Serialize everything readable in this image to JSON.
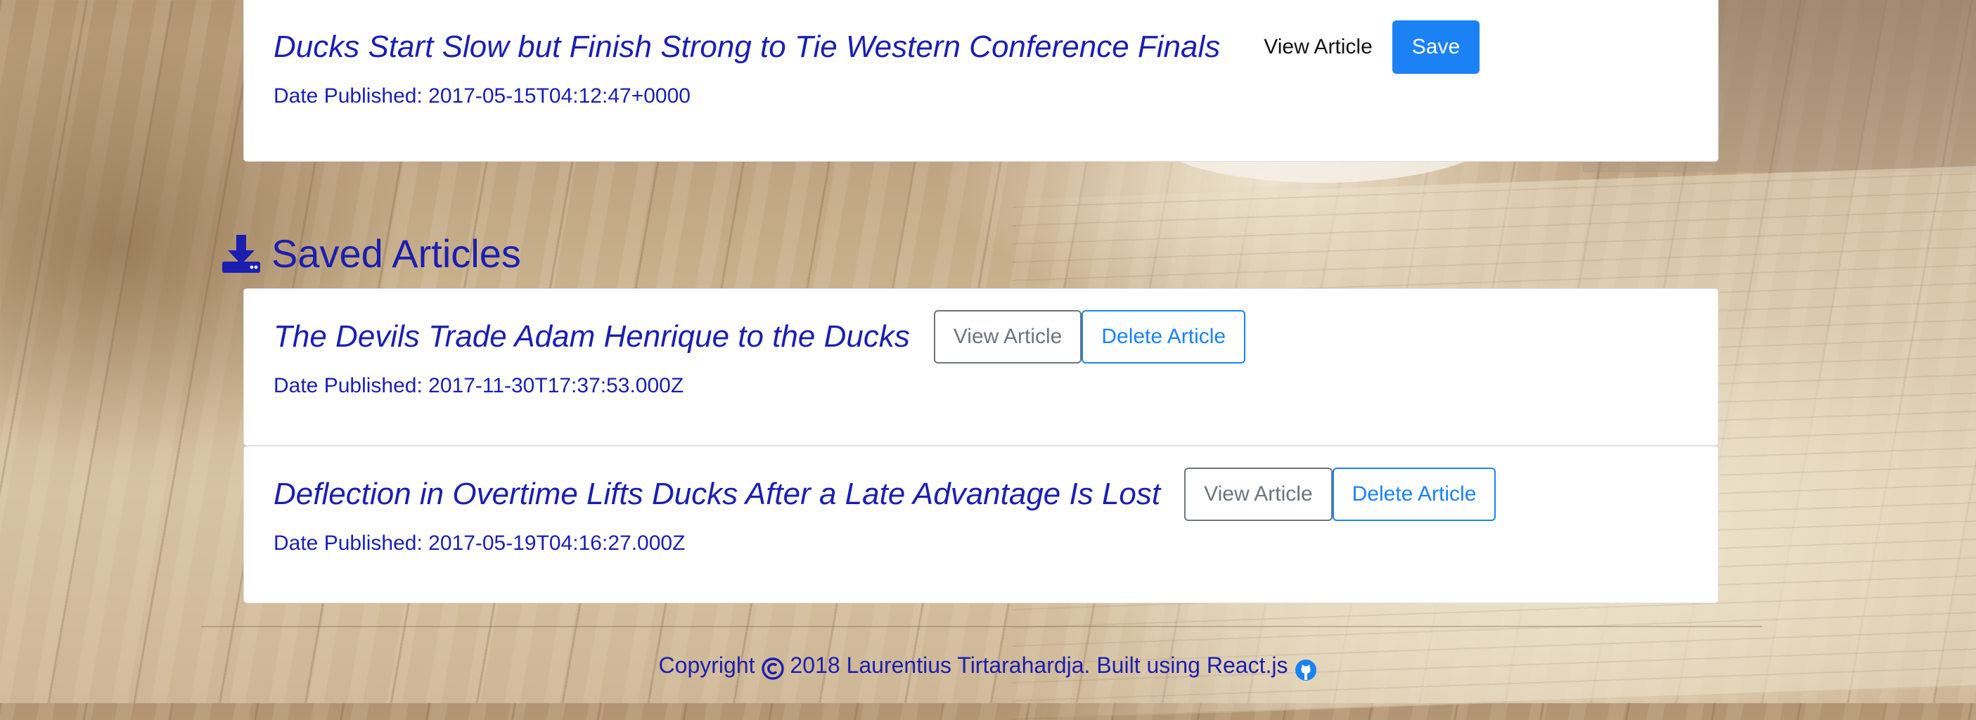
{
  "search_results": {
    "articles": [
      {
        "title": "Ducks Start Slow but Finish Strong to Tie Western Conference Finals",
        "view_label": "View Article",
        "action_label": "Save",
        "date_text": "Date Published: 2017-05-15T04:12:47+0000"
      }
    ]
  },
  "saved": {
    "heading": "Saved Articles",
    "heading_icon": "download-icon",
    "articles": [
      {
        "title": "The Devils Trade Adam Henrique to the Ducks",
        "view_label": "View Article",
        "action_label": "Delete Article",
        "date_text": "Date Published: 2017-11-30T17:37:53.000Z"
      },
      {
        "title": "Deflection in Overtime Lifts Ducks After a Late Advantage Is Lost",
        "view_label": "View Article",
        "action_label": "Delete Article",
        "date_text": "Date Published: 2017-05-19T04:16:27.000Z"
      }
    ]
  },
  "footer": {
    "copyright_label": "Copyright",
    "copyright_icon": "copyright-icon",
    "credit_text": "2018 Laurentius Tirtarahardja. Built using React.js",
    "github_icon": "github-icon"
  },
  "colors": {
    "heading_text": "#1b1faf",
    "primary": "#1a82f5",
    "secondary": "#6c757d",
    "card_background": "#ffffff"
  }
}
